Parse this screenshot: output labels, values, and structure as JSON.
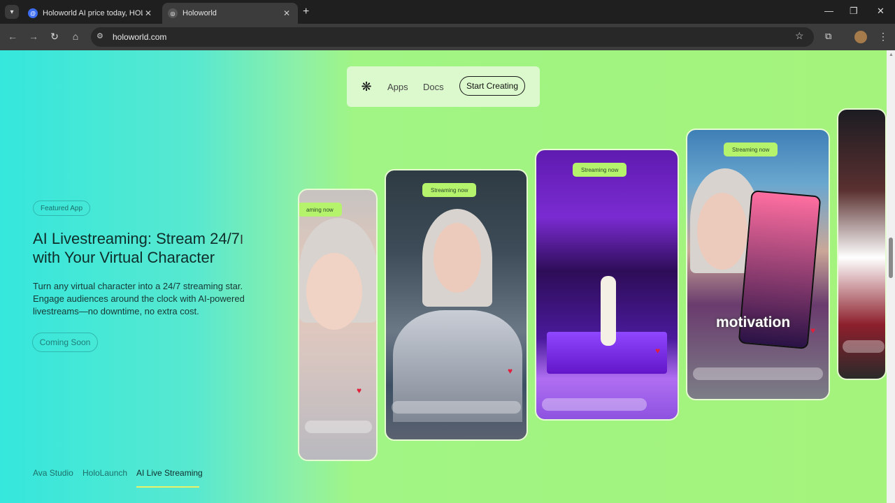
{
  "browser": {
    "tabs": [
      {
        "title": "Holoworld AI price today, HOLO",
        "active": false
      },
      {
        "title": "Holoworld",
        "active": true
      }
    ],
    "url": "holoworld.com",
    "new_tab": "+",
    "window_controls": [
      "minimize-icon",
      "restore-icon",
      "close-icon"
    ]
  },
  "nav": {
    "apps": "Apps",
    "docs": "Docs",
    "start_creating": "Start Creating"
  },
  "hero": {
    "badge": "Featured App",
    "headline": "AI Livestreaming: Stream 24/7 with Your Virtual Character",
    "description": "Turn any virtual character into a 24/7 streaming star. Engage audiences around the clock with AI-powered livestreams—no downtime, no extra cost.",
    "coming_soon": "Coming Soon"
  },
  "bottom_tabs": [
    {
      "label": "Ava Studio",
      "active": false
    },
    {
      "label": "HoloLaunch",
      "active": false
    },
    {
      "label": "AI Live Streaming",
      "active": true
    }
  ],
  "cards": {
    "chip": "Streaming now",
    "chip_partial": "aming now",
    "caption": "motivation"
  },
  "colors": {
    "page_left": "#35e7dc",
    "page_right": "#a4f37c",
    "chip": "#b6f36d",
    "active_tab_underline": "#eaf26a"
  }
}
